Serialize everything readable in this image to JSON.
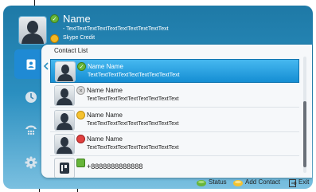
{
  "header": {
    "name": "Name",
    "mood": "- TextTextTextTextTextTextTextTextTextText",
    "credit": "Skype Credit"
  },
  "sidebar": {
    "items": [
      {
        "icon": "contacts-icon",
        "active": true
      },
      {
        "icon": "clock-icon",
        "active": false
      },
      {
        "icon": "dialpad-icon",
        "active": false
      },
      {
        "icon": "gear-icon",
        "active": false
      }
    ]
  },
  "contact_list": {
    "title": "Contact List",
    "contacts": [
      {
        "name": "Name Name",
        "mood": "TextTextTextTextTextTextTextTextText",
        "status": "online",
        "selected": true
      },
      {
        "name": "Name Name",
        "mood": "TextTextTextTextTextTextTextTextText",
        "status": "offline",
        "selected": false
      },
      {
        "name": "Name Name",
        "mood": "TextTextTextTextTextTextTextTextText",
        "status": "away",
        "selected": false
      },
      {
        "name": "Name Name",
        "mood": "TextTextTextTextTextTextTextTextText",
        "status": "busy",
        "selected": false
      },
      {
        "name": "+8888888888888",
        "status": "online",
        "type": "phone",
        "selected": false
      }
    ]
  },
  "bottom_bar": {
    "status_label": "Status",
    "add_contact_label": "Add Contact",
    "exit_label": "Exit"
  },
  "colors": {
    "frame_top": "#1e79a6",
    "frame_bottom": "#7bc0e0",
    "selected_row": "#1a93d8",
    "online": "#67b53a",
    "away": "#f5c230",
    "busy": "#e04040"
  }
}
